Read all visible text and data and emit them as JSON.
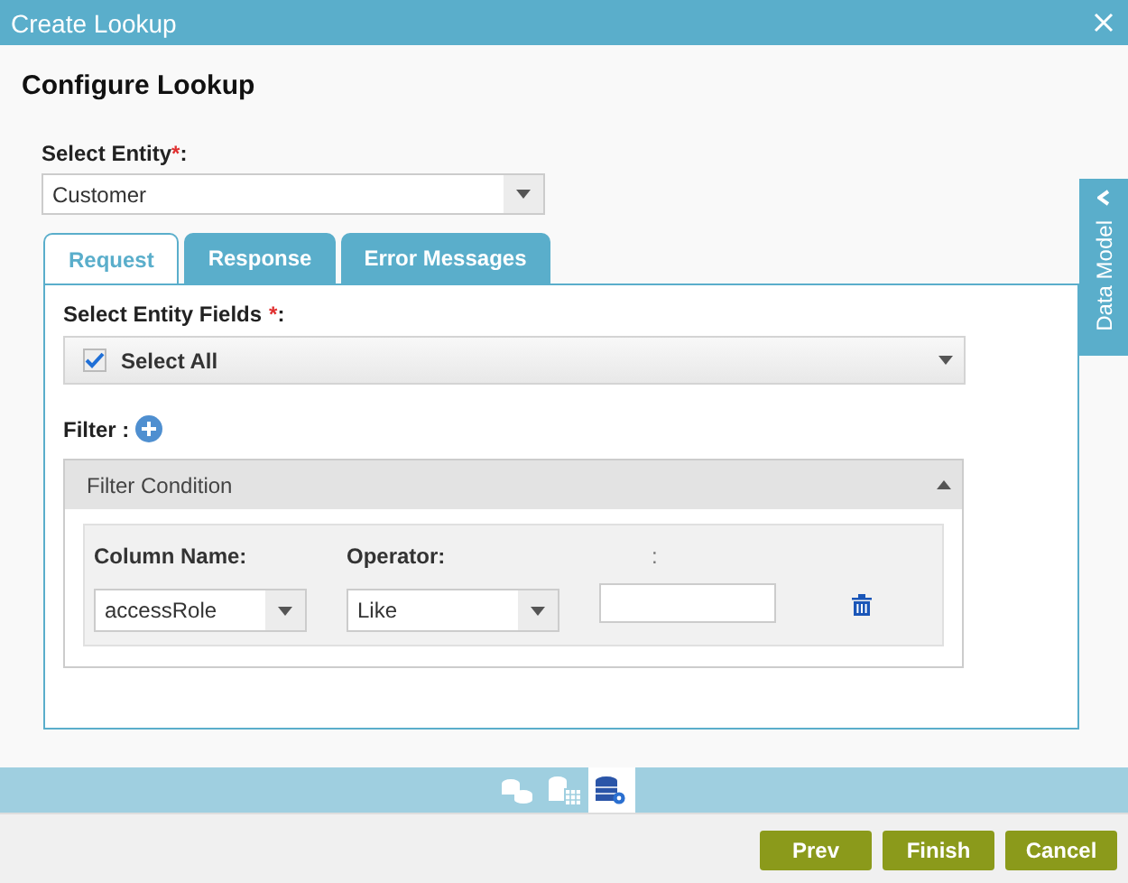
{
  "window": {
    "title": "Create Lookup"
  },
  "heading": "Configure Lookup",
  "entity": {
    "label": "Select Entity",
    "required_mark": "*",
    "colon": ":",
    "value": "Customer"
  },
  "tabs": [
    {
      "label": "Request",
      "selected": true
    },
    {
      "label": "Response",
      "selected": false
    },
    {
      "label": "Error Messages",
      "selected": false
    }
  ],
  "side_panel": {
    "label": "Data Model",
    "expanded": false
  },
  "entity_fields": {
    "label": "Select Entity Fields",
    "required_mark": "*",
    "colon": ":",
    "select_all": {
      "label": "Select All",
      "checked": true
    }
  },
  "filter": {
    "label": "Filter :",
    "condition": {
      "title": "Filter Condition",
      "expanded": true,
      "fields": [
        {
          "kind": "select",
          "label": "Column Name:",
          "value": "accessRole"
        },
        {
          "kind": "select",
          "label": "Operator:",
          "value": "Like"
        },
        {
          "kind": "text",
          "label": ":"
        }
      ]
    }
  },
  "steps": [
    {
      "kind": "stack",
      "selected": false
    },
    {
      "kind": "table",
      "selected": false
    },
    {
      "kind": "gear",
      "selected": true
    }
  ],
  "buttons": [
    "Prev",
    "Finish",
    "Cancel"
  ]
}
